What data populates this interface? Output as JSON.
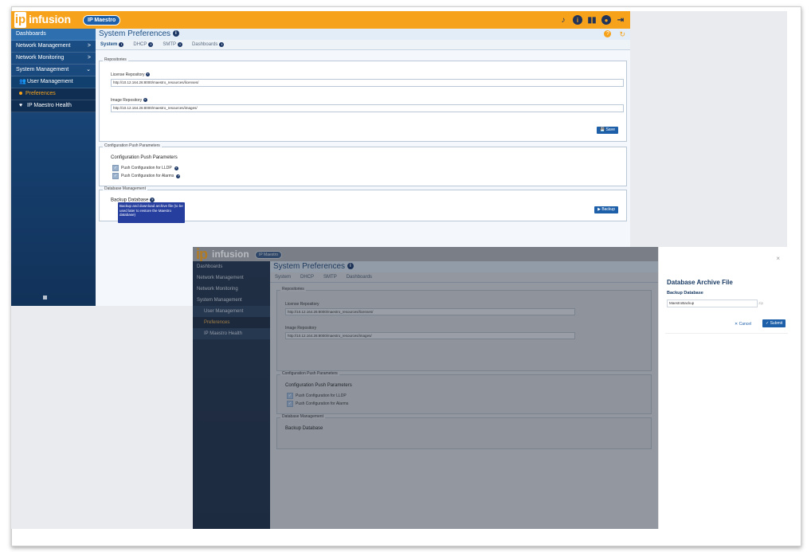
{
  "brand": {
    "logo_ip": "ip",
    "logo_text": "infusion",
    "product_pill": "IP Maestro"
  },
  "top_icons": [
    "bell-icon",
    "info-icon",
    "book-icon",
    "user-icon",
    "logout-icon"
  ],
  "sidebar": {
    "items": [
      {
        "label": "Dashboards"
      },
      {
        "label": "Network Management",
        "chevron": ">"
      },
      {
        "label": "Network Monitoring",
        "chevron": ">"
      },
      {
        "label": "System Management",
        "chevron": "⌄"
      },
      {
        "label": "User Management"
      },
      {
        "label": "Preferences"
      },
      {
        "label": "IP Maestro Health"
      }
    ]
  },
  "page": {
    "title": "System Preferences",
    "tabs": [
      "System",
      "DHCP",
      "SMTP",
      "Dashboards"
    ]
  },
  "repositories": {
    "legend": "Repositories",
    "license_label": "License Repository",
    "license_value": "http://10.12.164.26:8000/maestro_resources/licenses/",
    "image_label": "Image Repository",
    "image_value": "http://10.12.164.26:8000/maestro_resources/images/",
    "save_label": "Save"
  },
  "config_push": {
    "legend": "Configuration Push Parameters",
    "title": "Configuration Push Parameters",
    "lldp_label": "Push Configuration for LLDP",
    "alarms_label": "Push Configuration for Alarms"
  },
  "database": {
    "legend": "Database Management",
    "backup_label": "Backup Database",
    "tooltip": "Backup and download archive file (to be used later to restore the Maestro database)",
    "backup_button": "Backup"
  },
  "modal": {
    "title": "Database Archive File",
    "subtitle": "Backup Database",
    "input_value": "MaestroBackup",
    "extension": ".zip",
    "cancel_label": "Cancel",
    "submit_label": "Submit",
    "close": "×"
  },
  "colors": {
    "brand_orange": "#f7a21b",
    "primary_blue": "#1d5fa8",
    "sidebar_blue": "#1b4f86"
  }
}
